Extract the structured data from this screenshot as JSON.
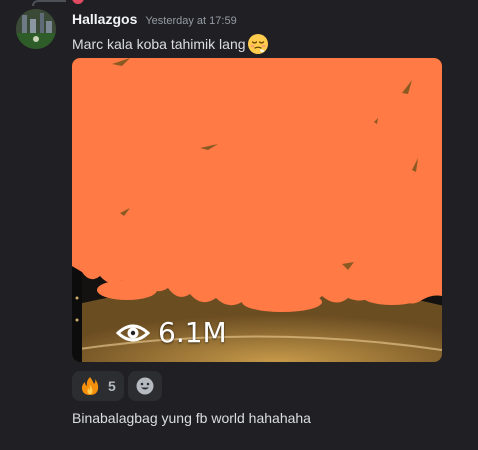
{
  "message": {
    "author": "Hallazgos",
    "timestamp": "Yesterday at 17:59",
    "content": "Marc kala koba tahimik lang",
    "emoji": "relieved-face"
  },
  "embed": {
    "views": "6.1M",
    "icon": "eye-icon"
  },
  "reactions": [
    {
      "emoji": "fire",
      "count": "5"
    }
  ],
  "add_reaction_icon": "smiley-icon",
  "next_message": {
    "content": "Binabalagbag yung fb world hahahaha"
  },
  "colors": {
    "background": "#202024",
    "username": "#f2f3f5",
    "timestamp": "#949ba4",
    "text": "#dbdee1",
    "overlay_orange": "#ff7a45",
    "reaction_bg": "#2b2d31"
  }
}
